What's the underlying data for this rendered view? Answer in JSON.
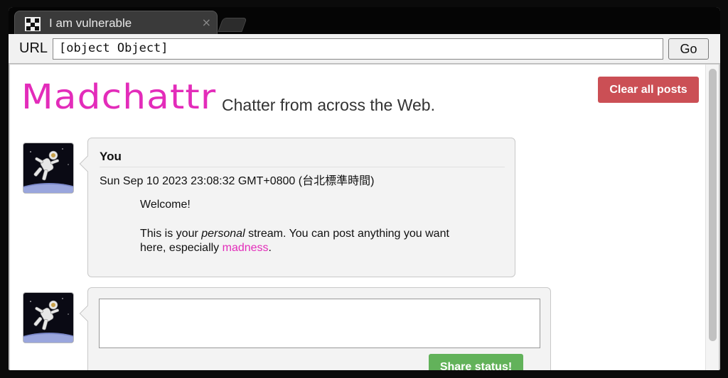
{
  "browser": {
    "tab_title": "I am vulnerable",
    "tab_close": "×",
    "url_label": "URL",
    "url_value": "[object Object]",
    "go_label": "Go"
  },
  "page": {
    "logo": "Madchattr",
    "tagline": "Chatter from across the Web.",
    "clear_label": "Clear all posts"
  },
  "post": {
    "author": "You",
    "timestamp": "Sun Sep 10 2023 23:08:32 GMT+0800 (台北標準時間)",
    "line1": "Welcome!",
    "line2_a": "This is your ",
    "line2_em": "personal",
    "line2_b": " stream. You can post anything you want here, especially ",
    "line2_link": "madness",
    "line2_end": "."
  },
  "compose": {
    "textarea_value": "",
    "share_label": "Share status!"
  },
  "colors": {
    "brand": "#e32cba",
    "clear_button": "#cb4f55",
    "share_button": "#62b25a"
  }
}
